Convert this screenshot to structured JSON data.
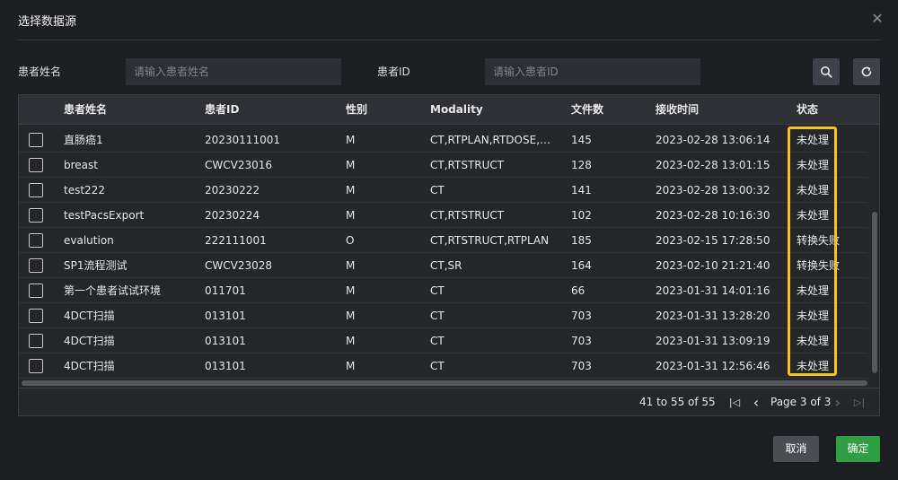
{
  "dialog": {
    "title": "选择数据源",
    "close_glyph": "✕"
  },
  "filters": {
    "name_label": "患者姓名",
    "name_placeholder": "请输入患者姓名",
    "id_label": "患者ID",
    "id_placeholder": "请输入患者ID",
    "search_icon": "search-icon",
    "refresh_icon": "refresh-icon"
  },
  "table": {
    "columns": [
      "患者姓名",
      "患者ID",
      "性别",
      "Modality",
      "文件数",
      "接收时间",
      "状态"
    ],
    "rows": [
      {
        "name": "直肠癌1",
        "id": "20230111001",
        "sex": "M",
        "modality": "CT,RTPLAN,RTDOSE,RTSTRUCT",
        "files": "145",
        "time": "2023-02-28 13:06:14",
        "status": "未处理"
      },
      {
        "name": "breast",
        "id": "CWCV23016",
        "sex": "M",
        "modality": "CT,RTSTRUCT",
        "files": "128",
        "time": "2023-02-28 13:01:15",
        "status": "未处理"
      },
      {
        "name": "test222",
        "id": "20230222",
        "sex": "M",
        "modality": "CT",
        "files": "141",
        "time": "2023-02-28 13:00:32",
        "status": "未处理"
      },
      {
        "name": "testPacsExport",
        "id": "20230224",
        "sex": "M",
        "modality": "CT,RTSTRUCT",
        "files": "102",
        "time": "2023-02-28 10:16:30",
        "status": "未处理"
      },
      {
        "name": "evalution",
        "id": "222111001",
        "sex": "O",
        "modality": "CT,RTSTRUCT,RTPLAN",
        "files": "185",
        "time": "2023-02-15 17:28:50",
        "status": "转换失败"
      },
      {
        "name": "SP1流程测试",
        "id": "CWCV23028",
        "sex": "M",
        "modality": "CT,SR",
        "files": "164",
        "time": "2023-02-10 21:21:40",
        "status": "转换失败"
      },
      {
        "name": "第一个患者试试环境",
        "id": "011701",
        "sex": "M",
        "modality": "CT",
        "files": "66",
        "time": "2023-01-31 14:01:16",
        "status": "未处理"
      },
      {
        "name": "4DCT扫描",
        "id": "013101",
        "sex": "M",
        "modality": "CT",
        "files": "703",
        "time": "2023-01-31 13:28:20",
        "status": "未处理"
      },
      {
        "name": "4DCT扫描",
        "id": "013101",
        "sex": "M",
        "modality": "CT",
        "files": "703",
        "time": "2023-01-31 13:09:19",
        "status": "未处理"
      },
      {
        "name": "4DCT扫描",
        "id": "013101",
        "sex": "M",
        "modality": "CT",
        "files": "703",
        "time": "2023-01-31 12:56:46",
        "status": "未处理"
      }
    ]
  },
  "pager": {
    "summary": "41 to 55 of 55",
    "page_text": "Page 3 of 3",
    "first_glyph": "|◁",
    "prev_glyph": "‹",
    "next_glyph": "›",
    "last_glyph": "▷|"
  },
  "footer": {
    "cancel_label": "取消",
    "ok_label": "确定"
  },
  "colors": {
    "highlight": "#f5c518",
    "ok_button": "#2f9e44",
    "cancel_button": "#4a4d53"
  }
}
